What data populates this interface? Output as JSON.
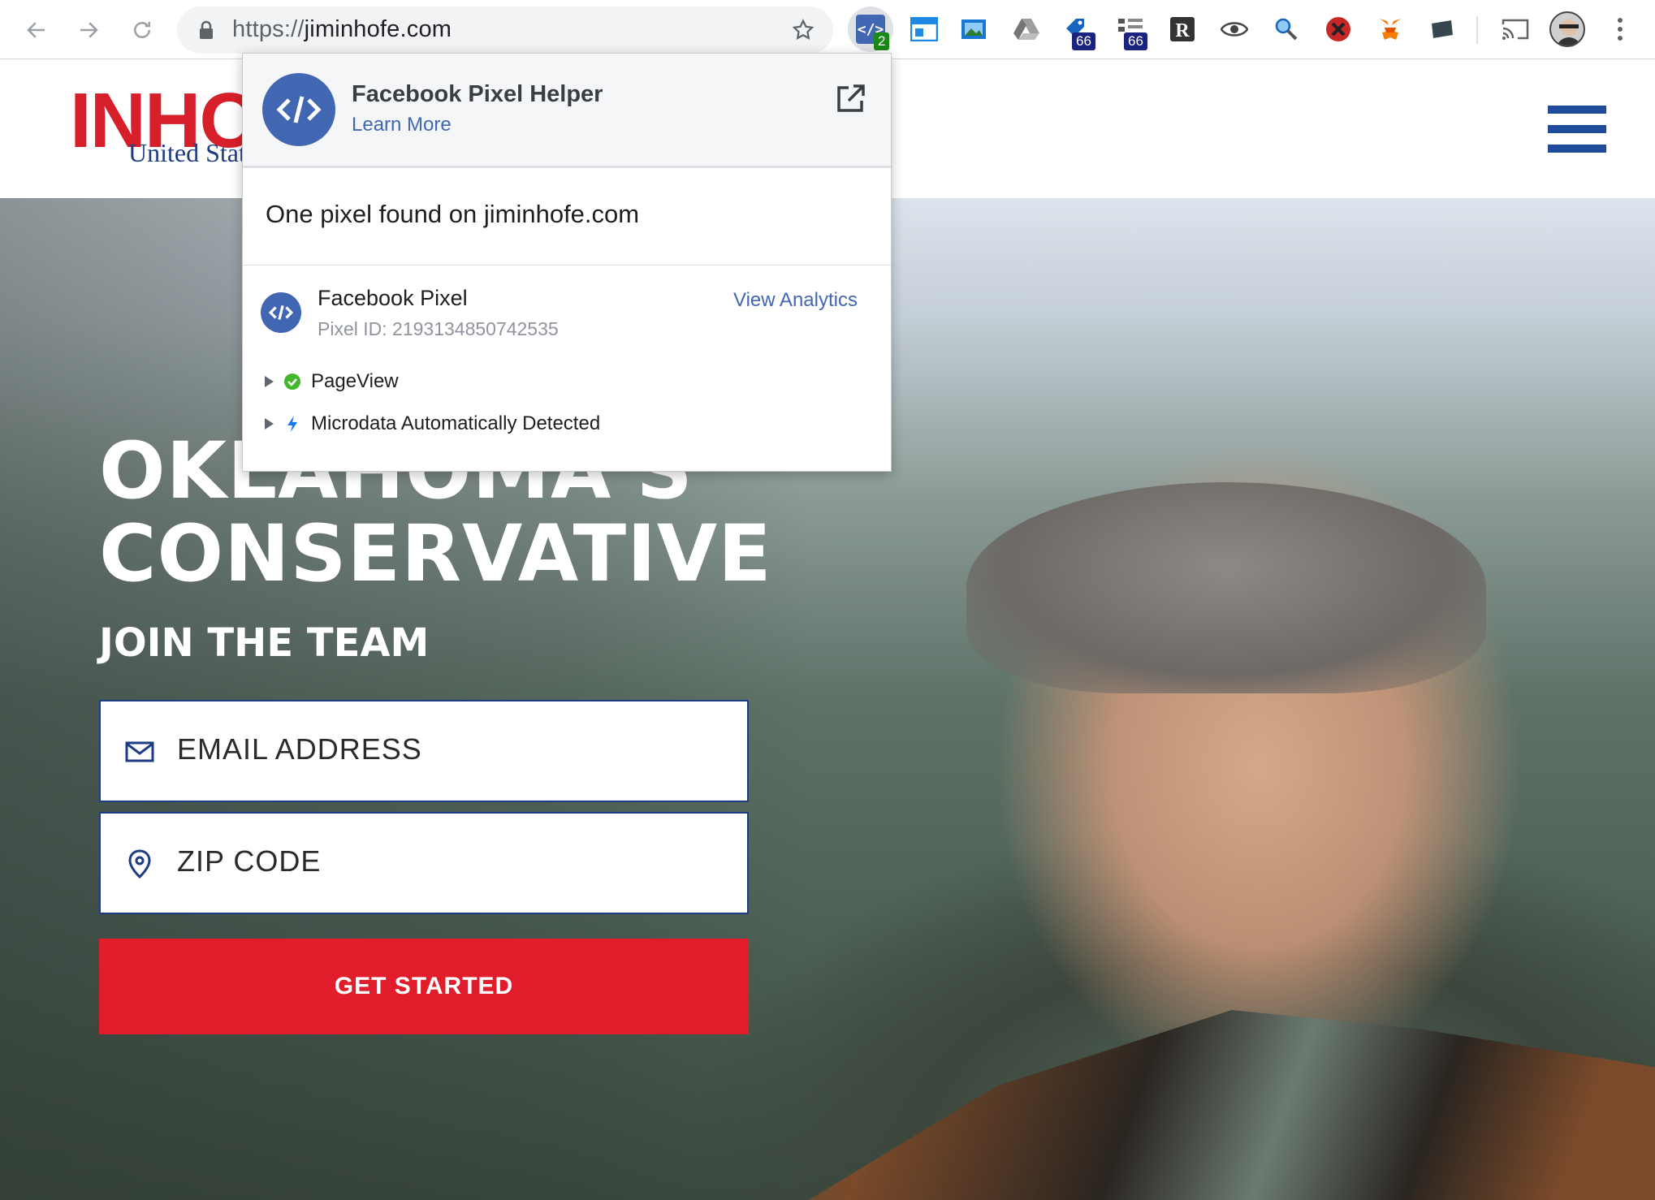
{
  "browser": {
    "url_scheme": "https://",
    "url_host": "jiminhofe.com",
    "active_extension_badge": "2",
    "extension_badges": [
      "66",
      "66"
    ],
    "extension_icons": [
      "layout-icon",
      "photo-icon",
      "drive-icon",
      "tag-icon",
      "code-tree-icon",
      "r-icon",
      "eye-icon",
      "search-tool-icon",
      "block-icon",
      "metamask-icon",
      "card-icon"
    ]
  },
  "site": {
    "logo_text": "INHO",
    "logo_subtext": "United Stat",
    "headline_line1": "OKLAHOMA'S",
    "headline_line2": "CONSERVATIVE",
    "subhead": "JOIN THE TEAM",
    "email_placeholder": "EMAIL ADDRESS",
    "zip_placeholder": "ZIP CODE",
    "cta_label": "GET STARTED"
  },
  "popup": {
    "title": "Facebook Pixel Helper",
    "learn_more": "Learn More",
    "summary": "One pixel found on jiminhofe.com",
    "pixel_name": "Facebook Pixel",
    "pixel_id": "Pixel ID: 2193134850742535",
    "view_analytics": "View Analytics",
    "events": [
      {
        "label": "PageView",
        "status": "success"
      },
      {
        "label": "Microdata Automatically Detected",
        "status": "info"
      }
    ]
  },
  "colors": {
    "fb_blue": "#4267b2",
    "brand_red": "#e11d2b",
    "brand_navy": "#1d3c84",
    "success_green": "#42b72a"
  }
}
